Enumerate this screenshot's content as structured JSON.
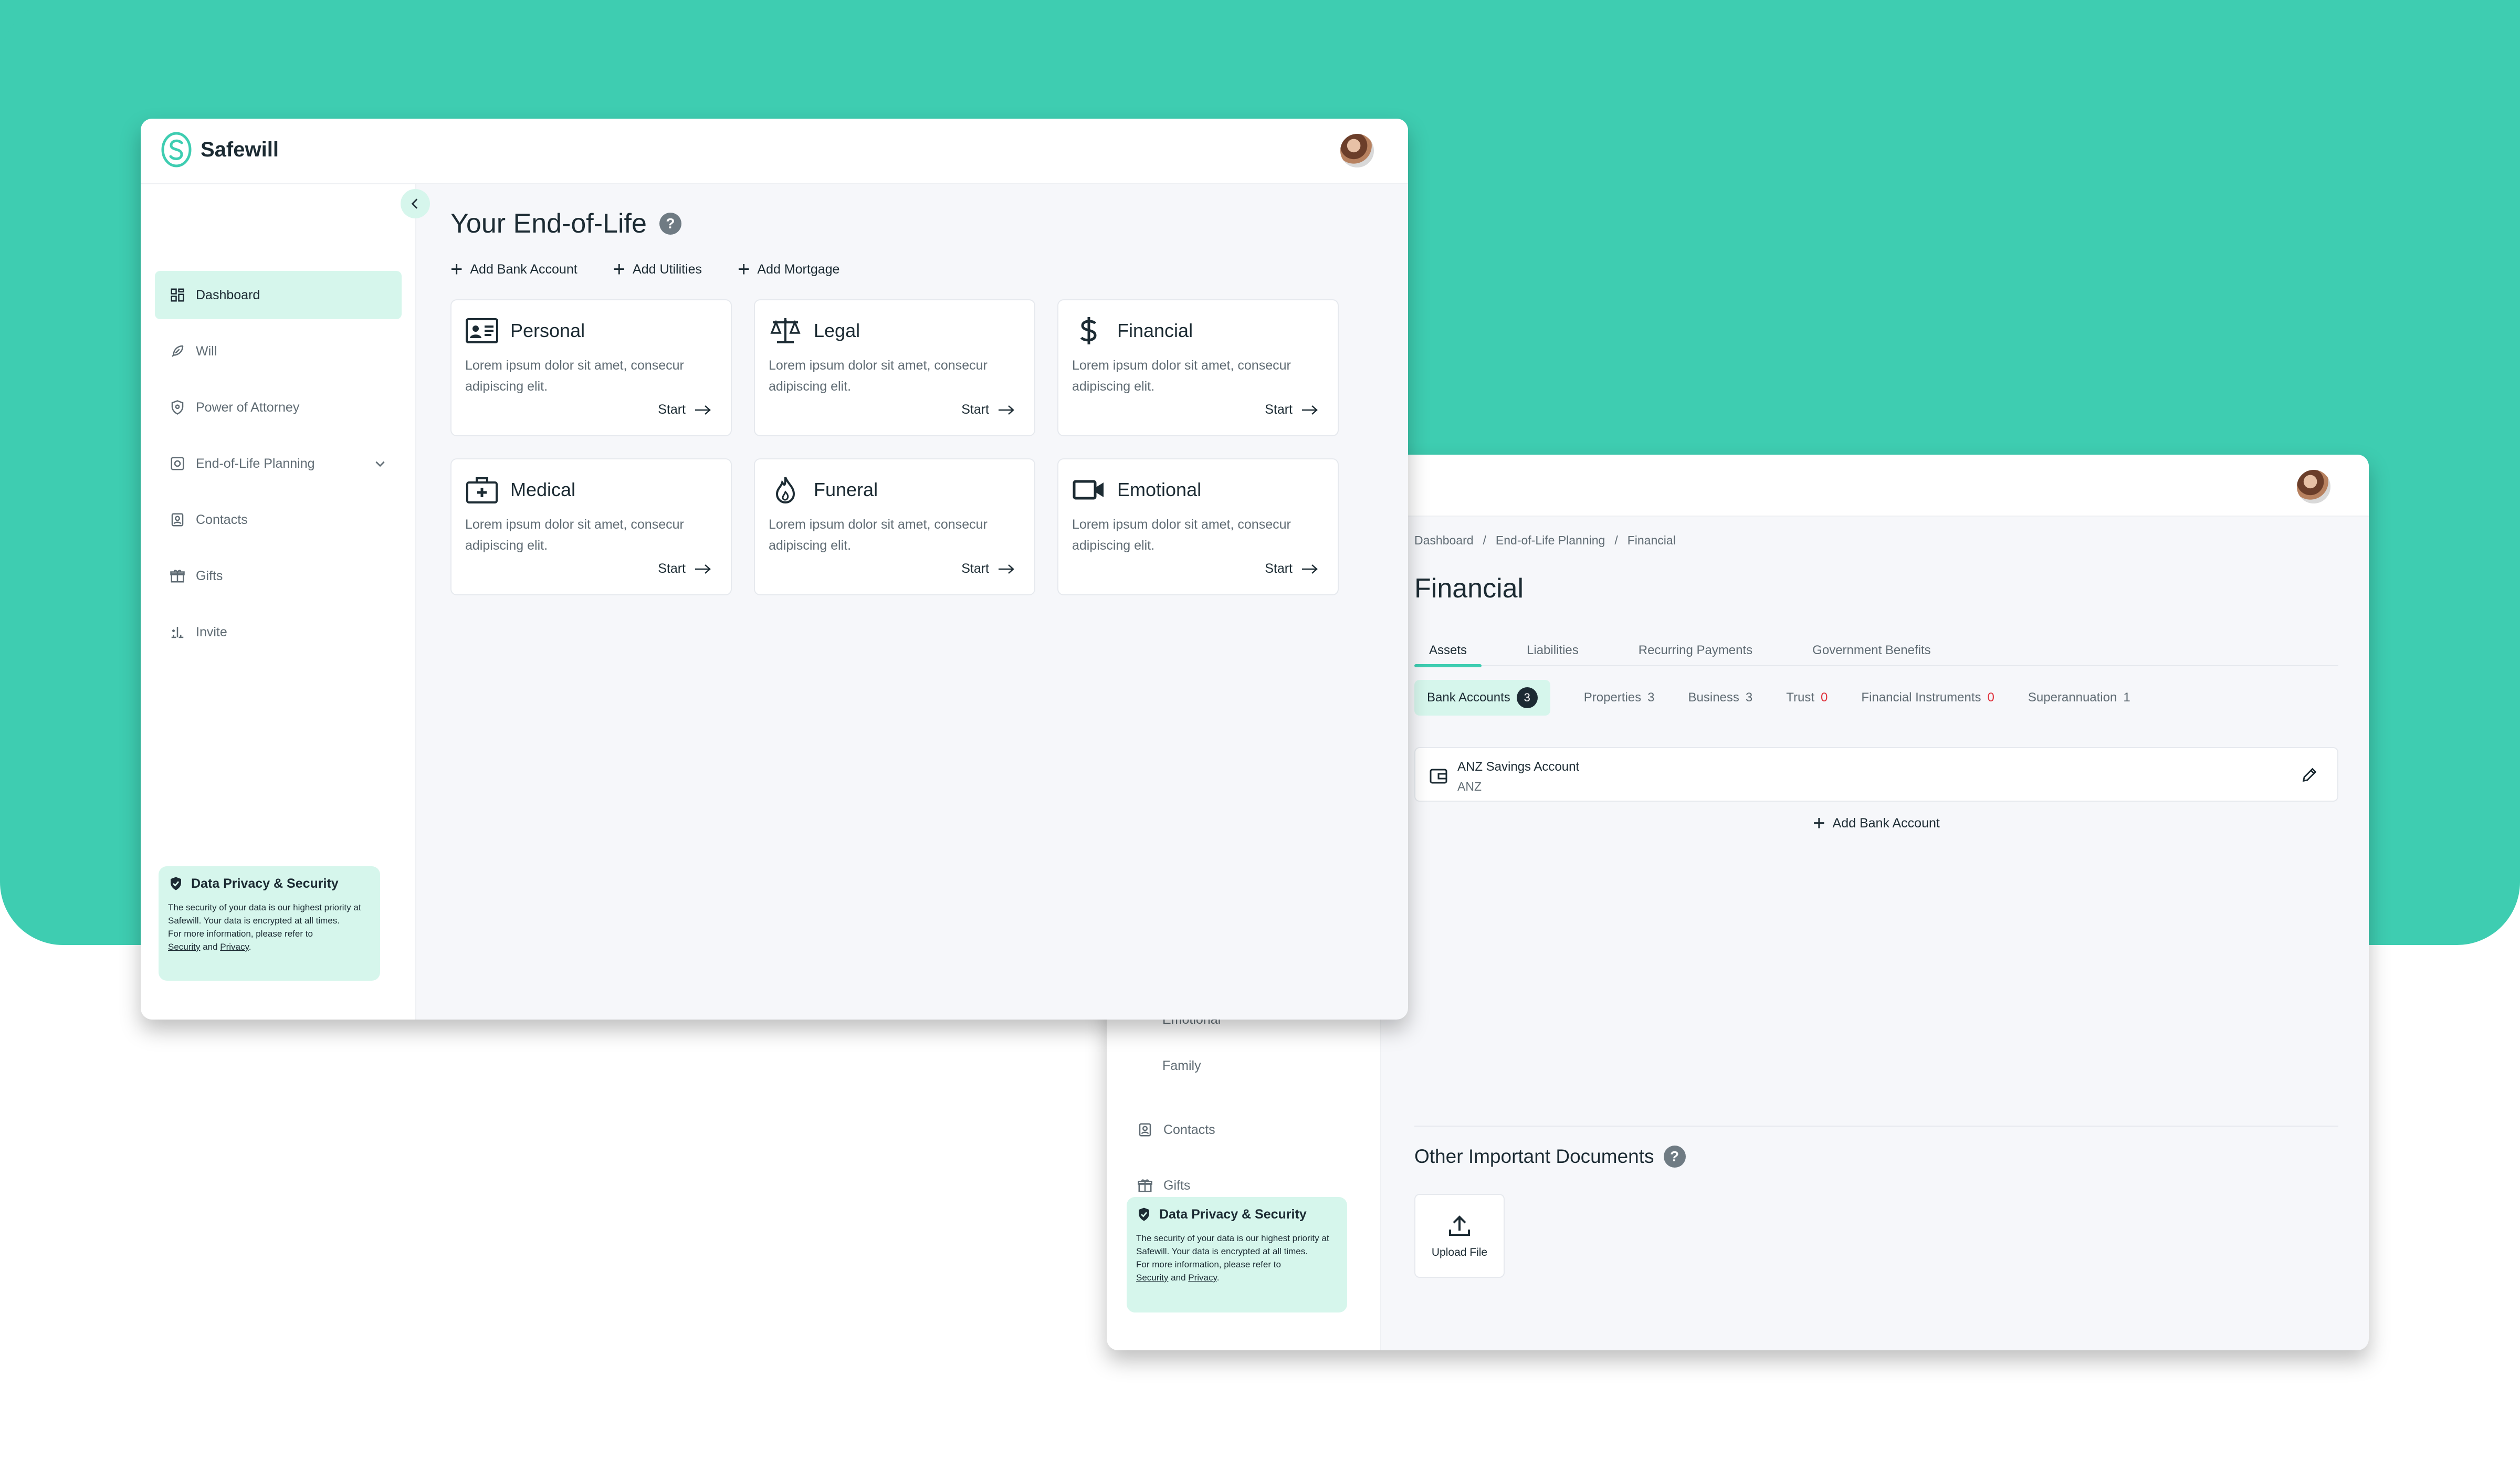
{
  "app": {
    "name": "Safewill"
  },
  "colors": {
    "accent": "#3ecdb1",
    "active_bg": "#d6f6ec",
    "text": "#1c2b33",
    "muted": "#5f6b73",
    "error": "#e0323c"
  },
  "window1": {
    "sidebar": {
      "items": [
        {
          "label": "Dashboard",
          "icon": "dashboard-icon",
          "active": true
        },
        {
          "label": "Will",
          "icon": "feather-icon"
        },
        {
          "label": "Power of Attorney",
          "icon": "shield-icon"
        },
        {
          "label": "End-of-Life Planning",
          "icon": "settings-box-icon",
          "expandable": true
        },
        {
          "label": "Contacts",
          "icon": "contacts-icon"
        },
        {
          "label": "Gifts",
          "icon": "gift-icon"
        },
        {
          "label": "Invite",
          "icon": "invite-icon"
        }
      ],
      "privacy": {
        "title": "Data Privacy & Security",
        "text": "The security of your data is our highest priority at Safewill. Your data is encrypted at all times.",
        "refer": "For more information, please refer to",
        "security_link": "Security",
        "and": "and",
        "privacy_link": "Privacy",
        "period": "."
      }
    },
    "main": {
      "title": "Your End-of-Life",
      "help": "?",
      "quick_actions": [
        "Add Bank Account",
        "Add Utilities",
        "Add Mortgage"
      ],
      "cards": [
        {
          "title": "Personal",
          "icon": "id-card-icon",
          "desc": "Lorem ipsum dolor sit amet, consecur adipiscing elit.",
          "action": "Start"
        },
        {
          "title": "Legal",
          "icon": "scales-icon",
          "desc": "Lorem ipsum dolor sit amet, consecur adipiscing elit.",
          "action": "Start"
        },
        {
          "title": "Financial",
          "icon": "dollar-icon",
          "desc": "Lorem ipsum dolor sit amet, consecur adipiscing elit.",
          "action": "Start"
        },
        {
          "title": "Medical",
          "icon": "medical-kit-icon",
          "desc": "Lorem ipsum dolor sit amet, consecur adipiscing elit.",
          "action": "Start"
        },
        {
          "title": "Funeral",
          "icon": "flame-icon",
          "desc": "Lorem ipsum dolor sit amet, consecur adipiscing elit.",
          "action": "Start"
        },
        {
          "title": "Emotional",
          "icon": "video-camera-icon",
          "desc": "Lorem ipsum dolor sit amet, consecur adipiscing elit.",
          "action": "Start"
        }
      ]
    }
  },
  "window2": {
    "sidebar": {
      "sub_items": [
        "Emotional",
        "Family"
      ],
      "items": [
        {
          "label": "Contacts",
          "icon": "contacts-icon"
        },
        {
          "label": "Gifts",
          "icon": "gift-icon"
        }
      ],
      "privacy": {
        "title": "Data Privacy & Security",
        "text": "The security of your data is our highest priority at Safewill. Your data is encrypted at all times.",
        "refer": "For more information, please refer to",
        "security_link": "Security",
        "and": "and",
        "privacy_link": "Privacy",
        "period": "."
      }
    },
    "main": {
      "breadcrumb": [
        "Dashboard",
        "/",
        "End-of-Life Planning",
        "/",
        "Financial"
      ],
      "title": "Financial",
      "tabs": [
        {
          "label": "Assets",
          "active": true
        },
        {
          "label": "Liabilities"
        },
        {
          "label": "Recurring Payments"
        },
        {
          "label": "Government Benefits"
        }
      ],
      "subtabs": [
        {
          "label": "Bank Accounts",
          "count": "3",
          "active": true
        },
        {
          "label": "Properties",
          "count": "3"
        },
        {
          "label": "Business",
          "count": "3"
        },
        {
          "label": "Trust",
          "count": "0",
          "alert": true
        },
        {
          "label": "Financial Instruments",
          "count": "0",
          "alert": true
        },
        {
          "label": "Superannuation",
          "count": "1"
        }
      ],
      "account": {
        "name": "ANZ Savings Account",
        "bank": "ANZ"
      },
      "add_bank": "Add Bank Account",
      "docs": {
        "title": "Other Important Documents",
        "help": "?",
        "upload_label": "Upload File"
      }
    }
  }
}
